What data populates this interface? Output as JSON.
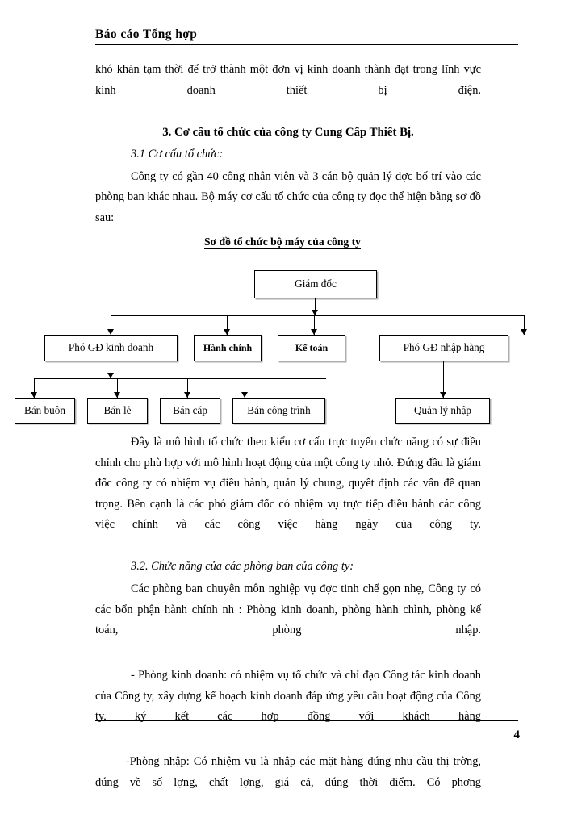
{
  "header": {
    "title": "Báo cáo Tổng hợp"
  },
  "body": {
    "para_intro": "khó khăn tạm thời để trở thành một đơn vị kinh doanh thành đạt trong lĩnh vực kinh doanh thiết bị điện.",
    "heading_3": "3. Cơ cấu tổ chức của công ty Cung Cấp Thiết Bị.",
    "heading_3_1": "3.1 Cơ cấu tổ chức:",
    "para_3_1": "Công ty có gần 40 công nhân viên và 3 cán bộ quản lý đợc   bố trí vào các phòng ban khác nhau. Bộ máy cơ cấu tổ chức của công ty đọc   thể hiện bằng sơ đồ sau:",
    "para_after_chart": "Đây là mô hình tổ chức theo kiểu cơ cấu trực tuyến chức năng có sự điều chỉnh cho phù hợp với mô hình hoạt động của một công ty nhỏ. Đứng đầu là giám đốc công ty có nhiệm vụ điều hành, quản lý chung, quyết định các vấn đề quan trọng. Bên cạnh là các phó giám đốc có nhiệm vụ trực tiếp điều hành các công việc chính và các công việc hàng ngày của công ty.",
    "heading_3_2": "3.2. Chức năng của các phòng ban của công ty:",
    "para_3_2": "Các phòng ban chuyên môn nghiệp vụ đợc   tinh chế gọn nhẹ, Công ty có các bổn phận hành chính nh   : Phòng kinh doanh, phòng hành chình, phòng kế toán, phòng nhập.",
    "para_kinh_doanh": "- Phòng kinh doanh: có nhiệm vụ tổ chức và chỉ đạo Công tác kinh doanh của Công ty, xây dựng kế hoạch kinh doanh đáp ứng yêu cầu hoạt động của Công ty, ký kết các hợp đồng với khách hàng",
    "para_phong_nhap": "-Phòng nhập: Có nhiệm vụ là nhập các mặt hàng đúng nhu cầu thị trờng,  đúng về số lợng,  chất lợng,  giá cả, đúng thời điểm. Có phơng"
  },
  "chart_data": {
    "type": "diagram",
    "title": "Sơ đồ tổ chức bộ máy của công ty",
    "levels": [
      {
        "level": 1,
        "nodes": [
          {
            "id": "giam-doc",
            "label": "Giám đốc"
          }
        ]
      },
      {
        "level": 2,
        "nodes": [
          {
            "id": "pho-gd-kinh-doanh",
            "label": "Phó GĐ kinh doanh"
          },
          {
            "id": "hanh-chinh",
            "label": "Hành chính"
          },
          {
            "id": "ke-toan",
            "label": "Kế toán"
          },
          {
            "id": "pho-gd-nhap-hang",
            "label": "Phó GĐ nhập hàng"
          }
        ]
      },
      {
        "level": 3,
        "nodes": [
          {
            "id": "ban-buon",
            "label": "Bán buôn"
          },
          {
            "id": "ban-le",
            "label": "Bán lẻ"
          },
          {
            "id": "ban-cap",
            "label": "Bán cáp"
          },
          {
            "id": "ban-cong-trinh",
            "label": "Bán công trình"
          },
          {
            "id": "quan-ly-nhap",
            "label": "Quản lý nhập"
          }
        ]
      }
    ],
    "edges": [
      {
        "from": "giam-doc",
        "to": "pho-gd-kinh-doanh"
      },
      {
        "from": "giam-doc",
        "to": "hanh-chinh"
      },
      {
        "from": "giam-doc",
        "to": "ke-toan"
      },
      {
        "from": "giam-doc",
        "to": "pho-gd-nhap-hang"
      },
      {
        "from": "pho-gd-kinh-doanh",
        "to": "ban-buon"
      },
      {
        "from": "pho-gd-kinh-doanh",
        "to": "ban-le"
      },
      {
        "from": "pho-gd-kinh-doanh",
        "to": "ban-cap"
      },
      {
        "from": "pho-gd-kinh-doanh",
        "to": "ban-cong-trinh"
      },
      {
        "from": "pho-gd-nhap-hang",
        "to": "quan-ly-nhap"
      }
    ]
  },
  "footer": {
    "page_number": "4"
  }
}
